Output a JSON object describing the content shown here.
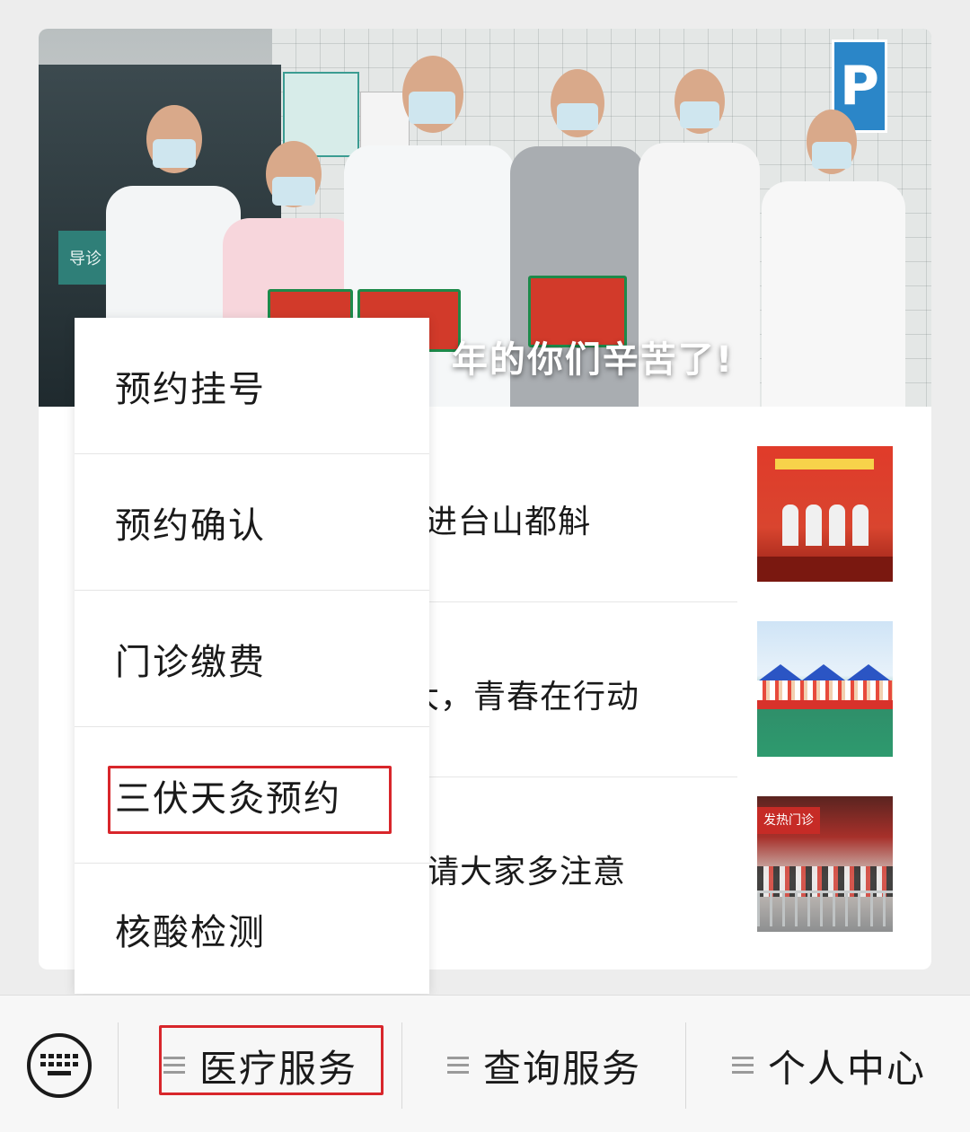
{
  "hero": {
    "caption": "年的你们辛苦了!",
    "door_sign": "导诊",
    "parking_sign": "P"
  },
  "news": [
    {
      "title": "进台山都斛"
    },
    {
      "title": "大，青春在行动"
    },
    {
      "title": "请大家多注意"
    }
  ],
  "thumbs": {
    "t3_sign": "发热门诊"
  },
  "popup_menu": {
    "items": [
      {
        "label": "预约挂号"
      },
      {
        "label": "预约确认"
      },
      {
        "label": "门诊缴费"
      },
      {
        "label": "三伏天灸预约"
      },
      {
        "label": "核酸检测"
      }
    ],
    "highlighted_item": "三伏天灸预约"
  },
  "menubar": {
    "keyboard_icon": "keyboard-icon",
    "tabs": [
      {
        "label": "医疗服务",
        "icon": "menu-lines-icon",
        "highlighted": true
      },
      {
        "label": "查询服务",
        "icon": "menu-lines-icon"
      },
      {
        "label": "个人中心",
        "icon": "menu-lines-icon"
      }
    ]
  },
  "colors": {
    "highlight": "#d8262b",
    "background": "#ededed"
  }
}
